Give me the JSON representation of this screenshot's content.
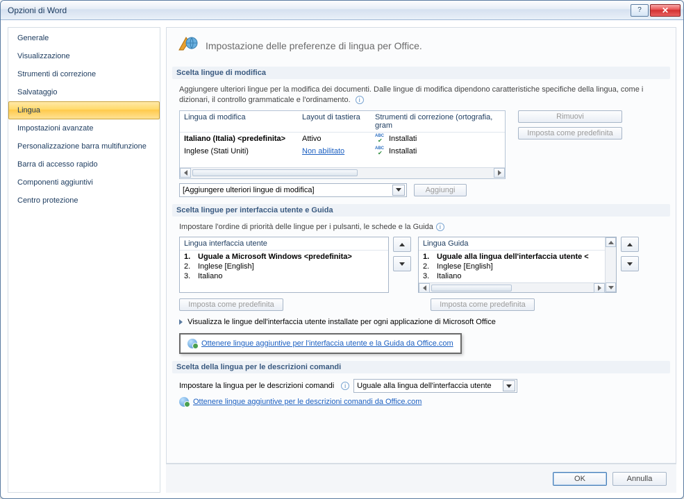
{
  "window": {
    "title": "Opzioni di Word"
  },
  "sidebar": {
    "items": [
      {
        "label": "Generale"
      },
      {
        "label": "Visualizzazione"
      },
      {
        "label": "Strumenti di correzione"
      },
      {
        "label": "Salvataggio"
      },
      {
        "label": "Lingua"
      },
      {
        "label": "Impostazioni avanzate"
      },
      {
        "label": "Personalizzazione barra multifunzione"
      },
      {
        "label": "Barra di accesso rapido"
      },
      {
        "label": "Componenti aggiuntivi"
      },
      {
        "label": "Centro protezione"
      }
    ],
    "selected_index": 4
  },
  "header": {
    "text": "Impostazione delle preferenze di lingua per Office."
  },
  "section1": {
    "title": "Scelta lingue di modifica",
    "desc": "Aggiungere ulteriori lingue per la modifica dei documenti. Dalle lingue di modifica dipendono caratteristiche specifiche della lingua, come i dizionari, il controllo grammaticale e l'ordinamento.",
    "table": {
      "cols": [
        "Lingua di modifica",
        "Layout di tastiera",
        "Strumenti di correzione (ortografia, gram"
      ],
      "rows": [
        {
          "lang": "Italiano (Italia) <predefinita>",
          "bold": true,
          "layout": "Attivo",
          "tools": "Installati"
        },
        {
          "lang": "Inglese (Stati Uniti)",
          "bold": false,
          "layout_link": "Non abilitato",
          "tools": "Installati"
        }
      ]
    },
    "remove": "Rimuovi",
    "set_default": "Imposta come predefinita",
    "add_combo": "[Aggiungere ulteriori lingue di modifica]",
    "add_btn": "Aggiungi"
  },
  "section2": {
    "title": "Scelta lingue per interfaccia utente e Guida",
    "desc": "Impostare l'ordine di priorità delle lingue per i pulsanti, le schede e la Guida",
    "ui_list": {
      "title": "Lingua interfaccia utente",
      "items": [
        {
          "n": "1.",
          "label": "Uguale a Microsoft Windows <predefinita>",
          "bold": true
        },
        {
          "n": "2.",
          "label": "Inglese [English]"
        },
        {
          "n": "3.",
          "label": "Italiano"
        }
      ],
      "set_default": "Imposta come predefinita"
    },
    "help_list": {
      "title": "Lingua Guida",
      "items": [
        {
          "n": "1.",
          "label": "Uguale alla lingua dell'interfaccia utente <",
          "bold": true
        },
        {
          "n": "2.",
          "label": "Inglese [English]"
        },
        {
          "n": "3.",
          "label": "Italiano"
        }
      ],
      "set_default": "Imposta come predefinita"
    },
    "expand": "Visualizza le lingue dell'interfaccia utente installate per ogni applicazione di Microsoft Office",
    "link": "Ottenere lingue aggiuntive per l'interfaccia utente e la Guida da Office.com"
  },
  "section3": {
    "title": "Scelta della lingua per le descrizioni comandi",
    "desc": "Impostare la lingua per le descrizioni comandi",
    "combo": "Uguale alla lingua dell'interfaccia utente",
    "link": "Ottenere lingue aggiuntive per le descrizioni comandi da Office.com"
  },
  "footer": {
    "ok": "OK",
    "cancel": "Annulla"
  }
}
